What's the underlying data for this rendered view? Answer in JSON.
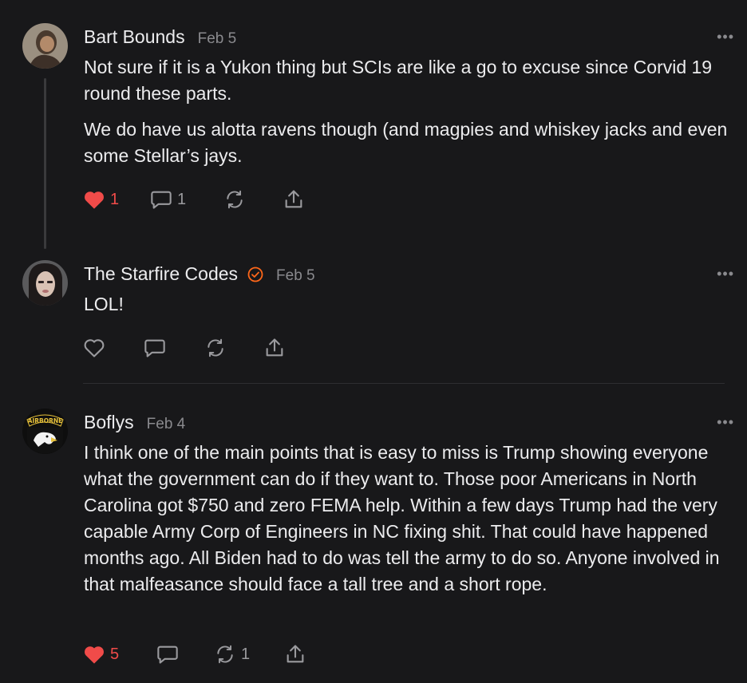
{
  "comments": [
    {
      "author": "Bart Bounds",
      "date": "Feb 5",
      "paragraphs": [
        "Not sure if it is a Yukon thing but SCIs are like a go to excuse since Corvid 19 round these parts.",
        "We do have us alotta ravens though (and magpies and whiskey jacks and even some Stellar’s jays."
      ],
      "likes": "1",
      "replies": "1",
      "restacks": "",
      "liked": true
    },
    {
      "author": "The Starfire Codes",
      "date": "Feb 5",
      "verified": true,
      "paragraphs": [
        "LOL!"
      ],
      "likes": "",
      "replies": "",
      "restacks": "",
      "liked": false
    },
    {
      "author": "Boflys",
      "date": "Feb 4",
      "avatar_text": "AIRBORNE",
      "paragraphs": [
        "I think one of the main points that is easy to miss is Trump showing everyone what the government can do if they want to. Those poor Americans in North Carolina got $750 and zero FEMA help. Within a few days Trump had the very capable Army Corp of Engineers in NC fixing shit. That could have happened months ago. All Biden had to do was tell the army to do so. Anyone involved in that malfeasance should face a tall tree and a short rope."
      ],
      "likes": "5",
      "replies": "",
      "restacks": "1",
      "liked": true
    }
  ],
  "more_label": "•••",
  "colors": {
    "background": "#18181a",
    "like": "#f04b49",
    "muted": "#8a8a8e",
    "verified": "#ff6719"
  },
  "icons": [
    "heart-icon",
    "comment-icon",
    "restack-icon",
    "share-icon",
    "more-icon",
    "verified-icon"
  ]
}
